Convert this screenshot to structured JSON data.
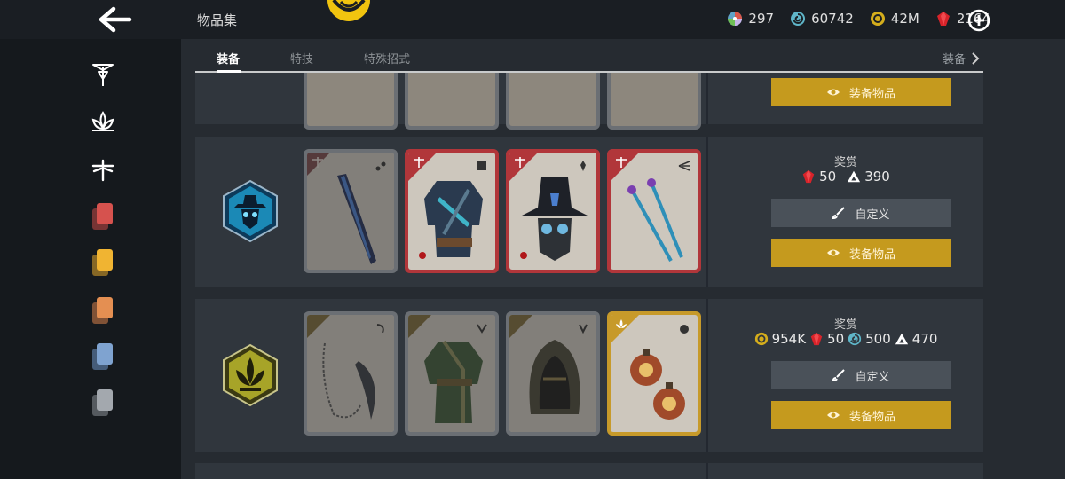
{
  "header": {
    "title": "物品集",
    "currencies": [
      {
        "icon": "orb-icon",
        "value": "297"
      },
      {
        "icon": "spiral-gem-icon",
        "value": "60742"
      },
      {
        "icon": "coin-icon",
        "value": "42M"
      },
      {
        "icon": "ruby-icon",
        "value": "2164"
      }
    ]
  },
  "tabs": {
    "items": [
      "装备",
      "特技",
      "特殊招式"
    ],
    "active": "装备",
    "right_label": "装备"
  },
  "sidebar": {
    "icons": [
      "dynasty-sigil-icon",
      "legion-lotus-icon",
      "heralds-dragonfly-icon",
      "red-cards-icon",
      "yellow-cards-icon",
      "orange-cards-icon",
      "blue-cards-icon",
      "grey-cards-icon"
    ]
  },
  "rows": [
    {
      "partial": true,
      "equip_label": "装备物品"
    },
    {
      "emblem": "masked-hat-emblem",
      "emblem_color": "#1b89b6",
      "cards": [
        {
          "name": "blade-weapon",
          "rarity": "epic-locked"
        },
        {
          "name": "armor",
          "rarity": "epic"
        },
        {
          "name": "helm",
          "rarity": "epic"
        },
        {
          "name": "twin-sticks",
          "rarity": "epic"
        }
      ],
      "reward_title": "奖赏",
      "rewards": [
        {
          "icon": "ruby-icon",
          "value": "50"
        },
        {
          "icon": "triangle-icon",
          "value": "390"
        }
      ],
      "custom_label": "自定义",
      "equip_label": "装备物品"
    },
    {
      "emblem": "lotus-emblem",
      "emblem_color": "#a7a428",
      "cards": [
        {
          "name": "chain-sickle",
          "rarity": "legendary-locked"
        },
        {
          "name": "robe",
          "rarity": "legendary-locked"
        },
        {
          "name": "hood",
          "rarity": "legendary-locked"
        },
        {
          "name": "bombs",
          "rarity": "legendary"
        }
      ],
      "reward_title": "奖赏",
      "rewards": [
        {
          "icon": "coin-icon",
          "value": "954K"
        },
        {
          "icon": "ruby-icon",
          "value": "50"
        },
        {
          "icon": "spiral-gem-icon",
          "value": "500"
        },
        {
          "icon": "triangle-icon",
          "value": "470"
        }
      ],
      "custom_label": "自定义",
      "equip_label": "装备物品"
    }
  ],
  "colors": {
    "epic": "#b1363a",
    "legendary": "#c79a2a",
    "equip_button": "#c59a1e",
    "custom_button": "#4a5159"
  }
}
